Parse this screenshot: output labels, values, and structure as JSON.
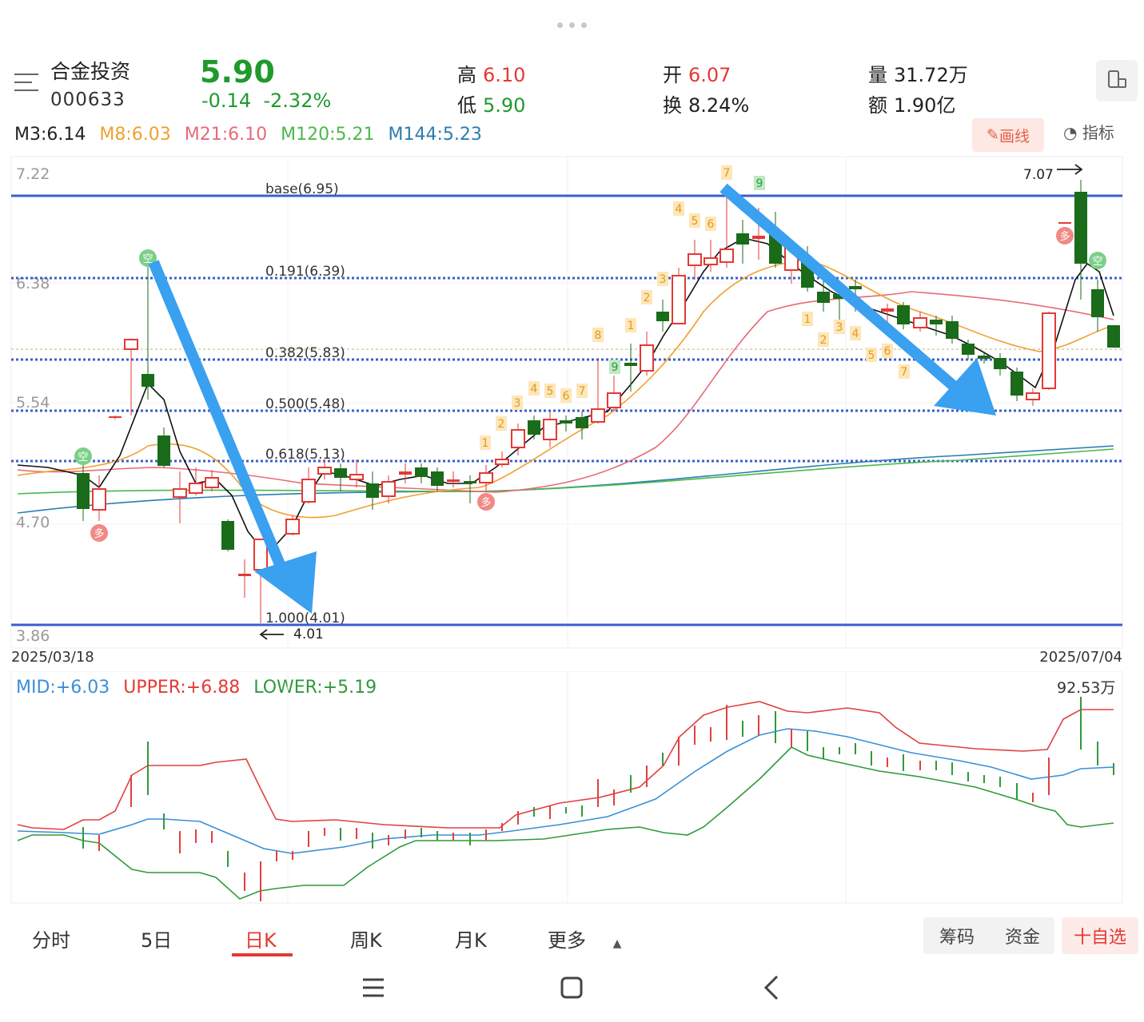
{
  "header": {
    "stock_name": "合金投资",
    "stock_code": "000633",
    "price": "5.90",
    "change": "-0.14",
    "change_pct": "-2.32%",
    "high_label": "高",
    "high": "6.10",
    "low_label": "低",
    "low": "5.90",
    "open_label": "开",
    "open": "6.07",
    "turnover_label": "换",
    "turnover": "8.24%",
    "volume_label": "量",
    "volume": "31.72万",
    "amount_label": "额",
    "amount": "1.90亿"
  },
  "ma_legend": [
    {
      "text": "M3:6.14",
      "color": "#222222"
    },
    {
      "text": "M8:6.03",
      "color": "#f0a030"
    },
    {
      "text": "M21:6.10",
      "color": "#e86a78"
    },
    {
      "text": "M120:5.21",
      "color": "#4cb84c"
    },
    {
      "text": "M144:5.23",
      "color": "#2a7db0"
    }
  ],
  "tools": {
    "draw_label": "画线",
    "indicator_label": "指标"
  },
  "main_chart": {
    "y_axis_labels": [
      "7.22",
      "6.38",
      "5.54",
      "4.70",
      "3.86"
    ],
    "start_date": "2025/03/18",
    "end_date": "2025/07/04",
    "fib_levels": [
      {
        "label": "base(6.95)"
      },
      {
        "label": "0.191(6.39)"
      },
      {
        "label": "0.382(5.83)"
      },
      {
        "label": "0.500(5.48)"
      },
      {
        "label": "0.618(5.13)"
      },
      {
        "label": "1.000(4.01)"
      }
    ],
    "high_marker": "7.07",
    "low_marker": "4.01",
    "signals": {
      "buy": "多",
      "sell": "空"
    },
    "td_numbers_up": [
      "1",
      "2",
      "3",
      "4",
      "5",
      "6",
      "7",
      "8",
      "1",
      "2",
      "3",
      "4",
      "5",
      "6",
      "7"
    ],
    "td_numbers_down": [
      "1",
      "2",
      "3",
      "4",
      "5",
      "6",
      "7",
      "9",
      "9"
    ]
  },
  "indicator": {
    "mid": "MID:+6.03",
    "upper": "UPPER:+6.88",
    "lower": "LOWER:+5.19",
    "volume_max": "92.53万"
  },
  "colors": {
    "up": "#e53935",
    "down": "#1a6b1a",
    "fib_solid": "#3a5fcd",
    "arrow": "#3aa0f0"
  },
  "tabs": [
    {
      "label": "分时",
      "active": false
    },
    {
      "label": "5日",
      "active": false
    },
    {
      "label": "日K",
      "active": true
    },
    {
      "label": "周K",
      "active": false
    },
    {
      "label": "月K",
      "active": false
    },
    {
      "label": "更多",
      "active": false
    }
  ],
  "bottom_buttons": {
    "chips": "筹码",
    "funds": "资金",
    "add_watch": "十自选"
  }
}
